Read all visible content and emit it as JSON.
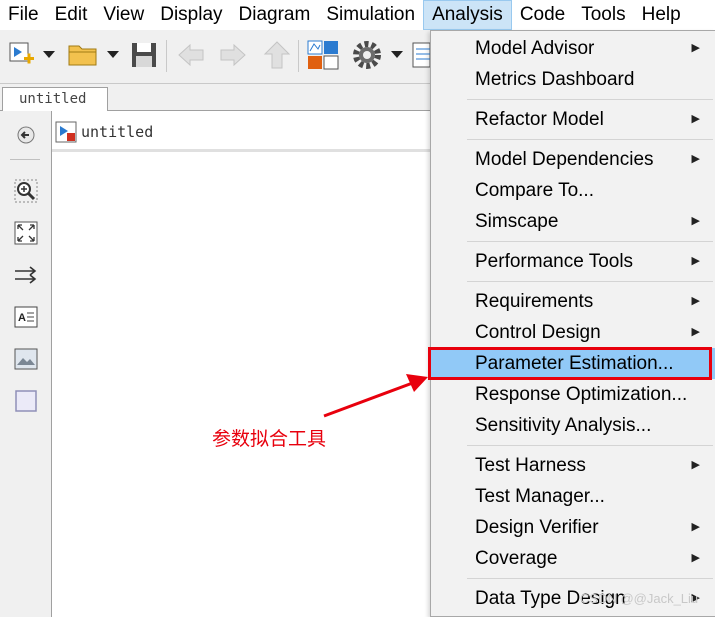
{
  "menubar": {
    "items": [
      "File",
      "Edit",
      "View",
      "Display",
      "Diagram",
      "Simulation",
      "Analysis",
      "Code",
      "Tools",
      "Help"
    ],
    "active": "Analysis"
  },
  "toolbar": {
    "icons": [
      "new-model-icon",
      "chevron-down-icon",
      "open-folder-icon",
      "chevron-down-icon",
      "save-icon",
      "back-arrow-icon",
      "forward-arrow-icon",
      "up-arrow-icon",
      "library-browser-icon",
      "settings-gear-icon",
      "chevron-down-icon",
      "model-explorer-icon"
    ]
  },
  "model_tab": {
    "label": "untitled"
  },
  "canvas": {
    "breadcrumb": "untitled"
  },
  "palette": {
    "icons": [
      "hide-browser-icon",
      "zoom-icon",
      "fit-to-view-icon",
      "signal-routing-icon",
      "annotation-icon",
      "image-icon",
      "area-icon"
    ]
  },
  "analysis_menu": {
    "items": [
      {
        "label": "Model Advisor",
        "submenu": true
      },
      {
        "label": "Metrics Dashboard",
        "submenu": false
      },
      {
        "label": "Refactor Model",
        "submenu": true
      },
      {
        "label": "Model Dependencies",
        "submenu": true
      },
      {
        "label": "Compare To...",
        "submenu": false
      },
      {
        "label": "Simscape",
        "submenu": true
      },
      {
        "label": "Performance Tools",
        "submenu": true
      },
      {
        "label": "Requirements",
        "submenu": true
      },
      {
        "label": "Control Design",
        "submenu": true
      },
      {
        "label": "Parameter Estimation...",
        "submenu": false,
        "highlighted": true
      },
      {
        "label": "Response Optimization...",
        "submenu": false
      },
      {
        "label": "Sensitivity Analysis...",
        "submenu": false
      },
      {
        "label": "Test Harness",
        "submenu": true
      },
      {
        "label": "Test Manager...",
        "submenu": false
      },
      {
        "label": "Design Verifier",
        "submenu": true
      },
      {
        "label": "Coverage",
        "submenu": true
      },
      {
        "label": "Data Type Design",
        "submenu": true
      }
    ],
    "highlight_color": "#91c9f7"
  },
  "annotation": {
    "text": "参数拟合工具",
    "color": "#e8000d"
  },
  "watermark": "CSDN @@Jack_Liu"
}
